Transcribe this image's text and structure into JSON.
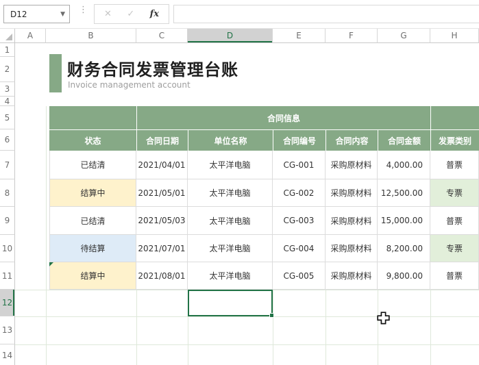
{
  "topbar": {
    "name_box_value": "D12",
    "cancel_label": "✕",
    "confirm_label": "✓",
    "fx_label": "fx",
    "formula_value": ""
  },
  "column_headers": [
    "A",
    "B",
    "C",
    "D",
    "E",
    "F",
    "G",
    "H"
  ],
  "selected_column": "D",
  "row_headers": [
    "1",
    "2",
    "3",
    "4",
    "5",
    "6",
    "7",
    "8",
    "9",
    "10",
    "11",
    "12",
    "13",
    "14"
  ],
  "selected_row": "12",
  "header_block": {
    "title": "财务合同发票管理台账",
    "subtitle": "Invoice management account"
  },
  "table": {
    "group_header": "合同信息",
    "columns": [
      "状态",
      "合同日期",
      "单位名称",
      "合同编号",
      "合同内容",
      "合同金额",
      "发票类别"
    ],
    "rows": [
      {
        "cells": [
          "已结清",
          "2021/04/01",
          "太平洋电脑",
          "CG-001",
          "采购原材料",
          "4,000.00",
          "普票"
        ],
        "fills": {}
      },
      {
        "cells": [
          "结算中",
          "2021/05/01",
          "太平洋电脑",
          "CG-002",
          "采购原材料",
          "12,500.00",
          "专票"
        ],
        "fills": {
          "0": "#FEF2CC",
          "6": "#E2EFDA"
        }
      },
      {
        "cells": [
          "已结清",
          "2021/05/03",
          "太平洋电脑",
          "CG-003",
          "采购原材料",
          "15,000.00",
          "普票"
        ],
        "fills": {}
      },
      {
        "cells": [
          "待结算",
          "2021/07/01",
          "太平洋电脑",
          "CG-004",
          "采购原材料",
          "8,200.00",
          "专票"
        ],
        "fills": {
          "0": "#DEEBF7",
          "6": "#E2EFDA"
        }
      },
      {
        "cells": [
          "结算中",
          "2021/08/01",
          "太平洋电脑",
          "CG-005",
          "采购原材料",
          "9,800.00",
          "普票"
        ],
        "fills": {
          "0": "#FEF2CC"
        },
        "error_indicator": true
      }
    ]
  },
  "selection": {
    "cell_ref": "D12"
  },
  "colors": {
    "header_green": "#86A986",
    "accent_green": "#86A986",
    "selection_green": "#217346",
    "fill_yellow": "#FEF2CC",
    "fill_blue": "#DEEBF7",
    "fill_light_green": "#E2EFDA",
    "gridline": "#DEE8DA"
  }
}
